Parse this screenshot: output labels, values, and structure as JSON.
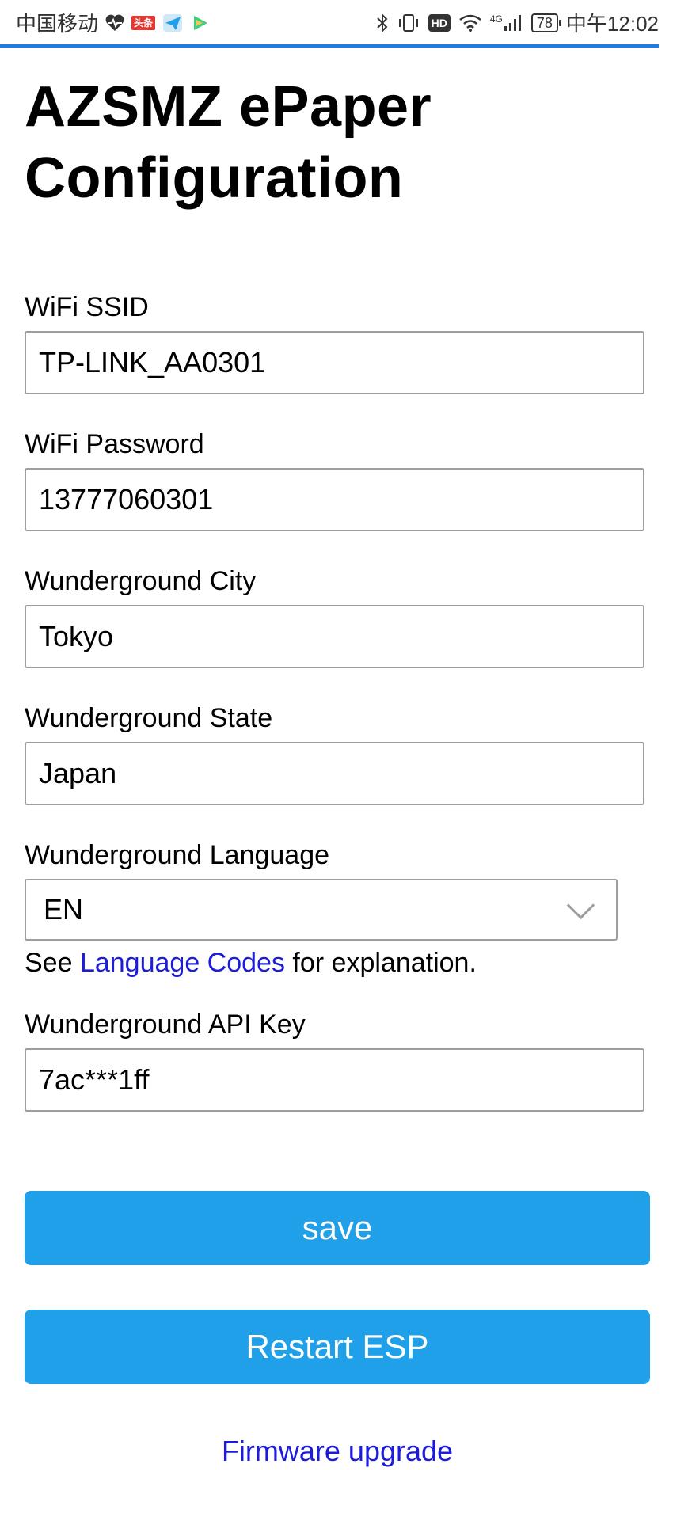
{
  "status_bar": {
    "carrier": "中国移动",
    "battery": "78",
    "network": "4G",
    "clock": "中午12:02",
    "notification_badge": "头条",
    "icons": [
      "heart-monitor-icon",
      "news-badge-icon",
      "paper-plane-icon",
      "video-play-icon",
      "bluetooth-icon",
      "vibrate-icon",
      "hd-icon",
      "wifi-icon",
      "signal-icon"
    ]
  },
  "page": {
    "title_line1": "AZSMZ ePaper",
    "title_line2": "Configuration"
  },
  "form": {
    "ssid_label": "WiFi SSID",
    "ssid_value": "TP-LINK_AA0301",
    "password_label": "WiFi Password",
    "password_value": "13777060301",
    "city_label": "Wunderground City",
    "city_value": "Tokyo",
    "state_label": "Wunderground State",
    "state_value": "Japan",
    "language_label": "Wunderground Language",
    "language_value": "EN",
    "hint_prefix": "See ",
    "hint_link": "Language Codes",
    "hint_suffix": " for explanation.",
    "apikey_label": "Wunderground API Key",
    "apikey_value": "7ac***1ff"
  },
  "actions": {
    "save_label": "save",
    "restart_label": "Restart ESP",
    "firmware_label": "Firmware upgrade"
  },
  "colors": {
    "button": "#1fa0e8",
    "link": "#1c1cd9",
    "progress": "#1f7be0"
  }
}
